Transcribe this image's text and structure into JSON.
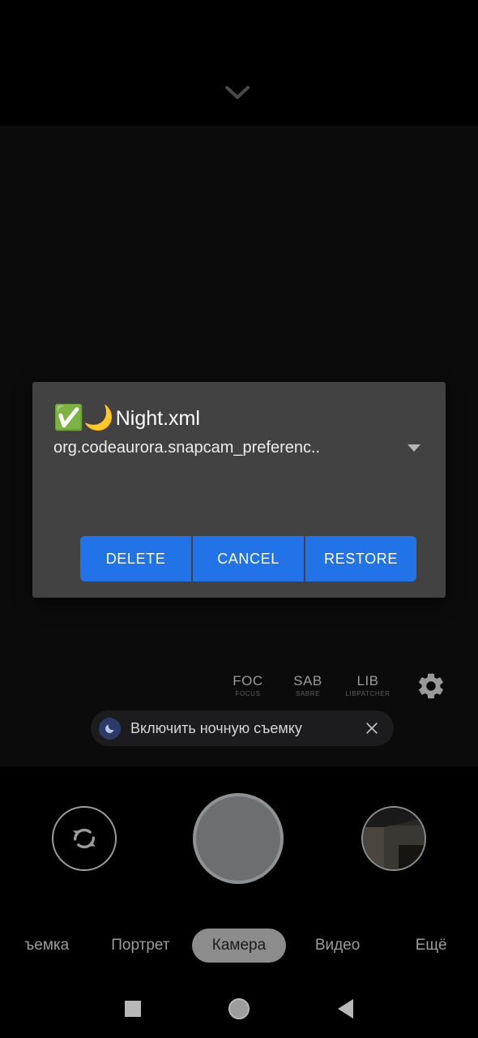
{
  "top_bar": {
    "chevron_icon": "chevron-down-icon"
  },
  "dialog": {
    "checkbox_emoji": "✅",
    "moon_emoji": "🌙",
    "title": "Night.xml",
    "subtitle": "org.codeaurora.snapcam_preferenc..",
    "dropdown_icon": "chevron-down-icon",
    "background_color": "#424242",
    "button_color": "#2272e8",
    "buttons": [
      {
        "label": "DELETE",
        "name": "delete-button"
      },
      {
        "label": "CANCEL",
        "name": "cancel-button"
      },
      {
        "label": "RESTORE",
        "name": "restore-button"
      }
    ]
  },
  "patcher_chips": [
    {
      "main": "FOC",
      "sub": "FOCUS"
    },
    {
      "main": "SAB",
      "sub": "SABRE"
    },
    {
      "main": "LIB",
      "sub": "LIBPATCHER"
    }
  ],
  "settings": {
    "gear_icon": "gear-icon"
  },
  "night_toast": {
    "icon": "moon-icon",
    "label": "Включить ночную съемку",
    "close_icon": "close-icon",
    "icon_color": "#2b3a67"
  },
  "camera_controls": {
    "switch_icon": "switch-camera-icon",
    "shutter_label": "shutter-button",
    "gallery_label": "gallery-thumbnail"
  },
  "mode_selector": {
    "modes": [
      {
        "label": "ъемка",
        "selected": false
      },
      {
        "label": "Портрет",
        "selected": false
      },
      {
        "label": "Камера",
        "selected": true
      },
      {
        "label": "Видео",
        "selected": false
      },
      {
        "label": "Ещё",
        "selected": false
      }
    ]
  },
  "nav_bar": {
    "recents_icon": "square-recents-icon",
    "home_icon": "circle-home-icon",
    "back_icon": "triangle-back-icon"
  }
}
